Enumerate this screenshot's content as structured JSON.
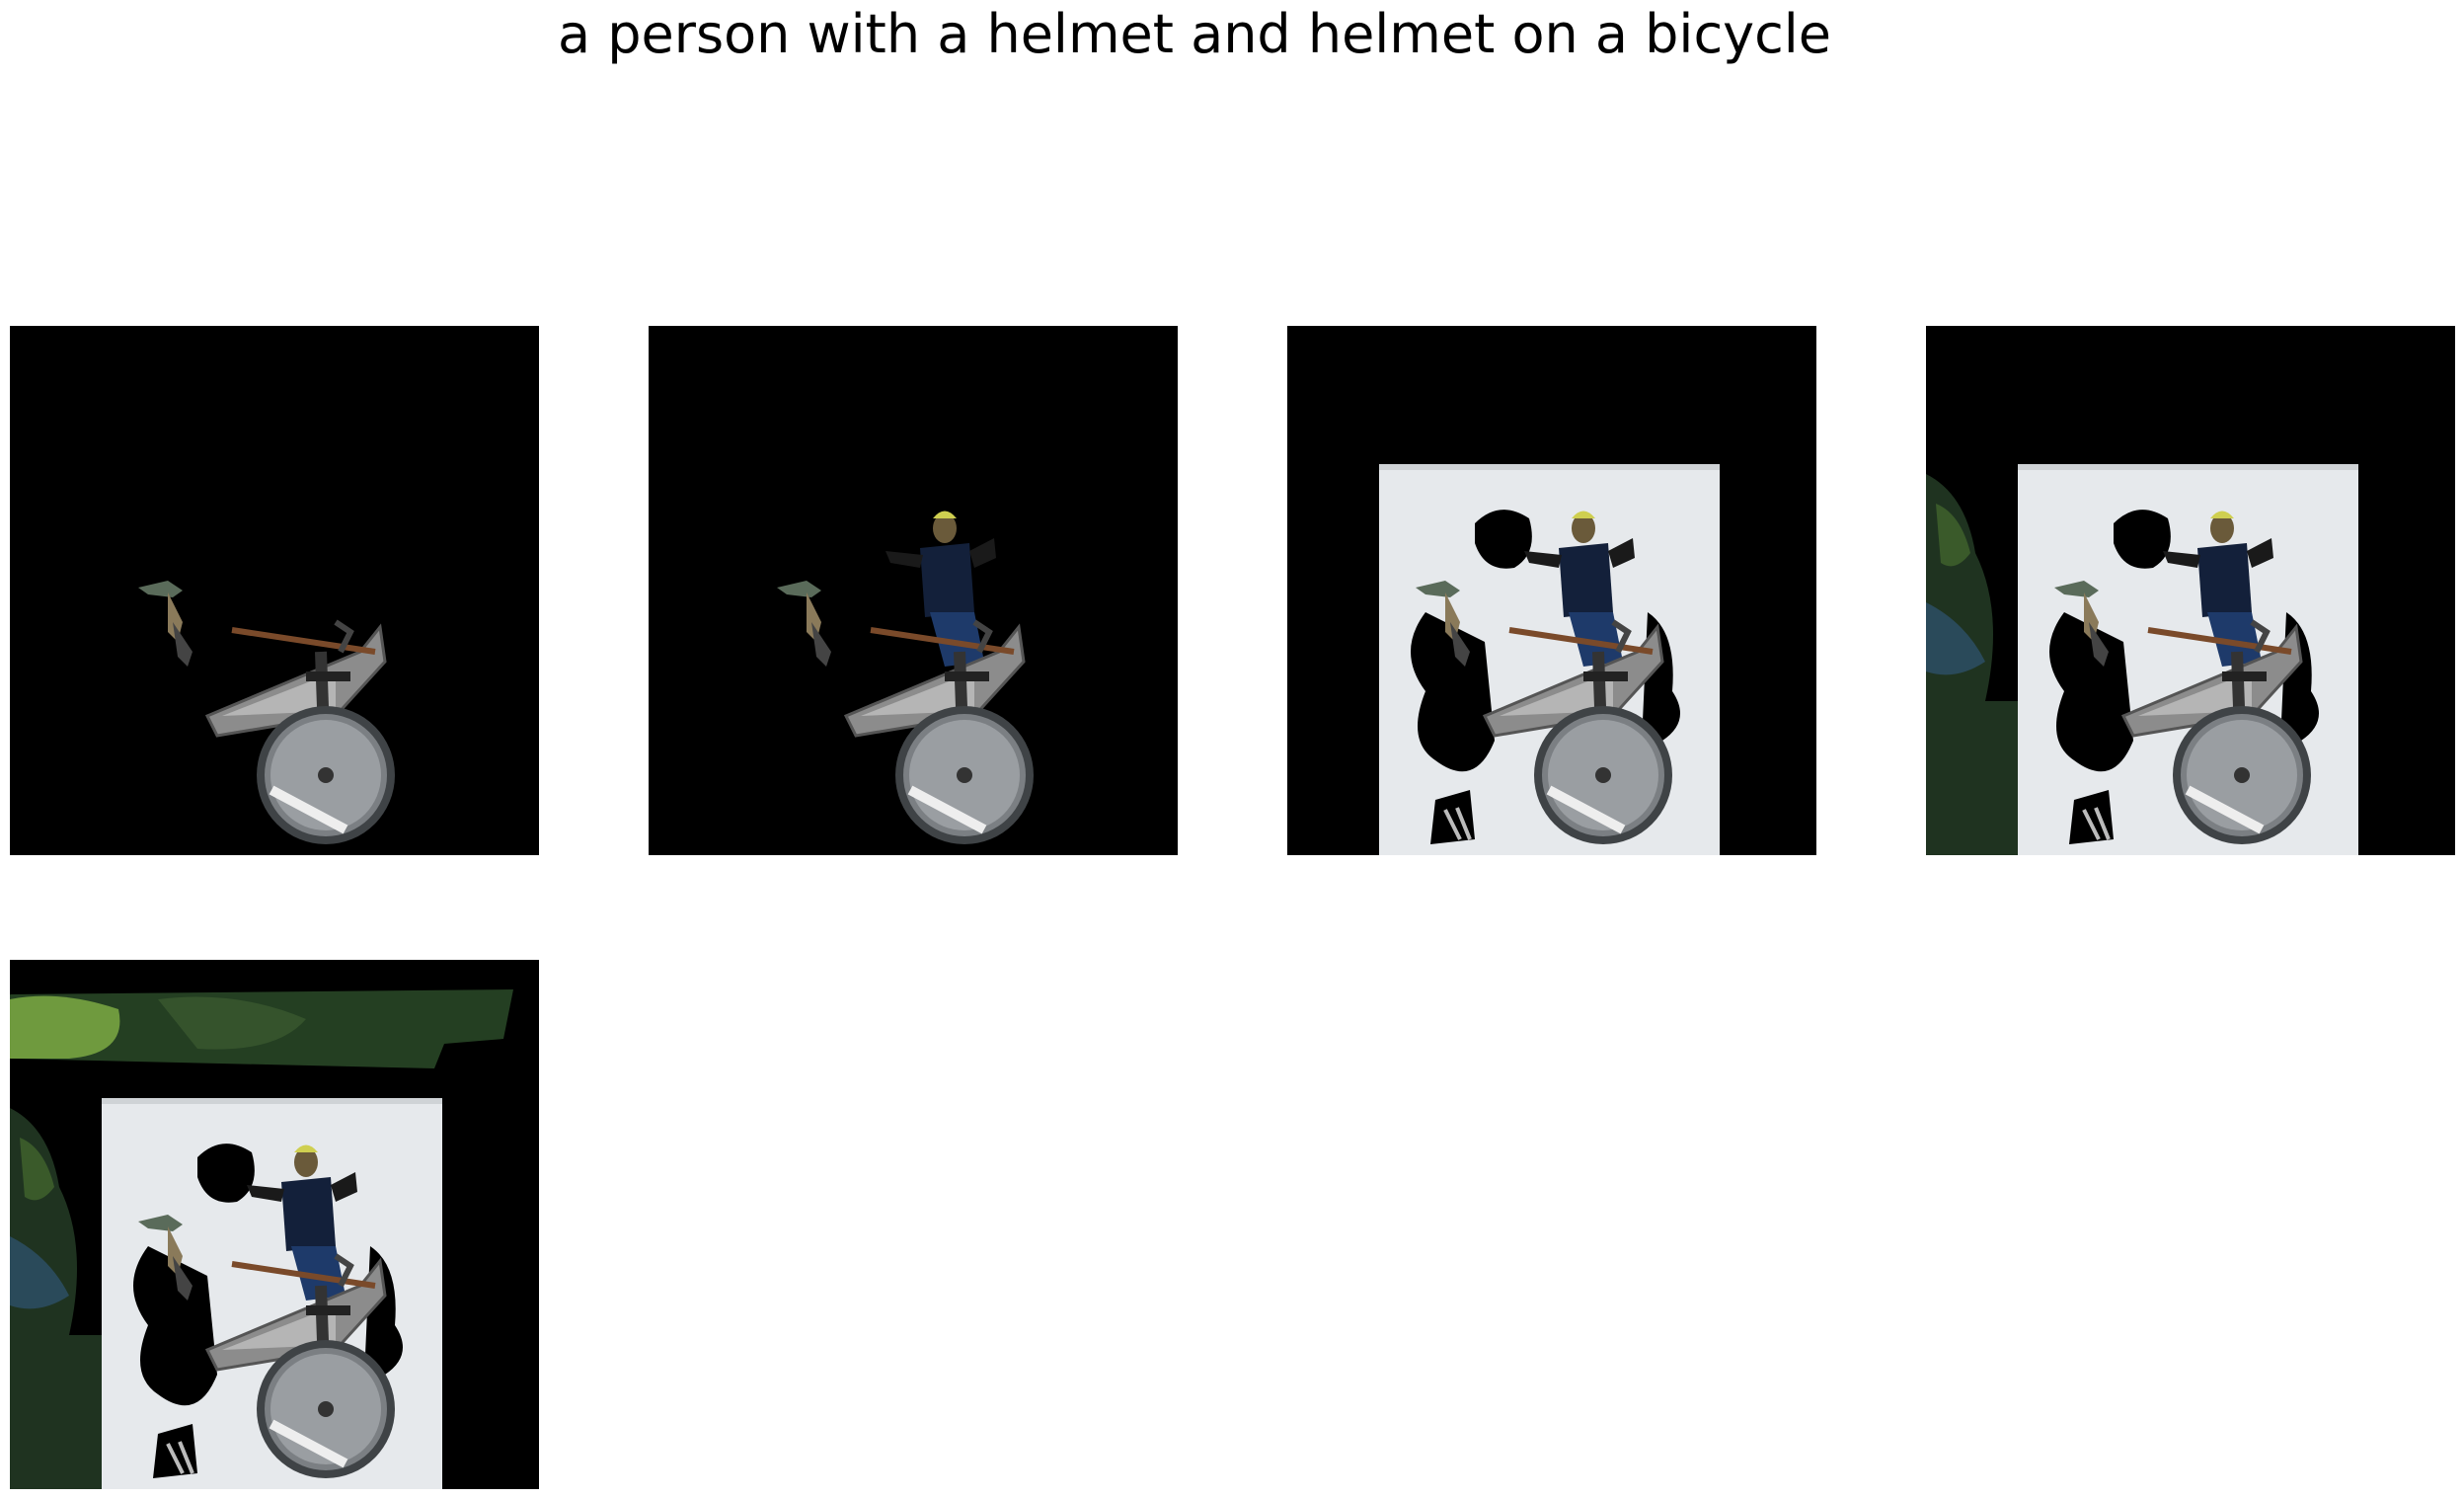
{
  "caption": "a person with a helmet and helmet on a bicycle",
  "colors": {
    "mask_background": "#000000",
    "wall": "#e6e9ec",
    "foliage_dark": "#1f3320",
    "foliage_light": "#6f9a3e",
    "wheel": "#3f4346",
    "frame": "#7a7a7a",
    "rider_shirt": "#13203a"
  },
  "panels": [
    {
      "name": "mask-step-1",
      "visible_content": [
        "bicycle"
      ]
    },
    {
      "name": "mask-step-2",
      "visible_content": [
        "bicycle",
        "person"
      ]
    },
    {
      "name": "mask-step-3",
      "visible_content": [
        "bicycle",
        "person",
        "wall"
      ]
    },
    {
      "name": "mask-step-4",
      "visible_content": [
        "bicycle",
        "person",
        "wall",
        "left-foliage"
      ]
    },
    {
      "name": "mask-step-5",
      "visible_content": [
        "bicycle",
        "person",
        "wall",
        "left-foliage",
        "top-foliage"
      ]
    }
  ]
}
